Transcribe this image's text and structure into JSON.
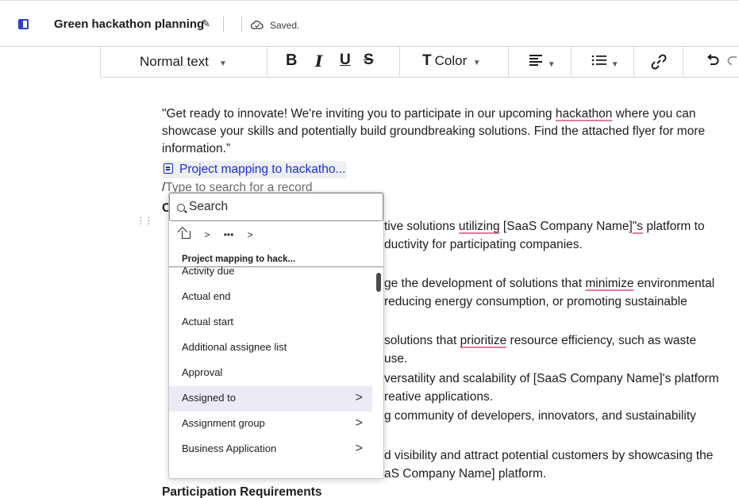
{
  "header": {
    "title": "Green hackathon planning",
    "status": "Saved."
  },
  "toolbar": {
    "format": "Normal text",
    "bold": "B",
    "italic": "I",
    "underline": "U",
    "strike": "S",
    "color_label": "Color",
    "color_glyph": "T"
  },
  "document": {
    "intro_1": "\"Get ready to innovate! We're inviting you to participate in our upcoming ",
    "intro_word": "hackathon",
    "intro_2": " where you can showcase your skills and potentially build groundbreaking solutions. Find the attached flyer for more information.”",
    "record_link": "Project mapping to hackatho...",
    "slash": "/",
    "slash_placeholder": "Type to search for a record",
    "hidden_initial": "O",
    "line1_a": "tive solutions ",
    "line1_word": "utilizing",
    "line1_b": " [SaaS Company Name]",
    "line1_c": "\"s",
    "line1_d": " platform to",
    "line2": "ductivity for participating companies.",
    "line3_a": "ge the development of solutions that ",
    "line3_word": "minimize",
    "line3_b": " environmental",
    "line4": "reducing energy consumption, or promoting sustainable",
    "line5_a": "solutions that ",
    "line5_word": "prioritize",
    "line5_b": " resource efficiency, such as waste",
    "line6": "use.",
    "line7": "versatility and scalability of [SaaS Company Name]'s platform",
    "line8": "reative applications.",
    "line9": "g community of developers, innovators, and sustainability",
    "line10": "d visibility and attract potential customers by showcasing the",
    "line11": "aS Company Name] platform.",
    "heading": "Participation Requirements"
  },
  "picker": {
    "search_placeholder": "Search",
    "crumb_sep": ">",
    "crumb_more": "•••",
    "group_title": "Project mapping to hack...",
    "items": [
      {
        "label": "Activity due",
        "has_children": false
      },
      {
        "label": "Actual end",
        "has_children": false
      },
      {
        "label": "Actual start",
        "has_children": false
      },
      {
        "label": "Additional assignee list",
        "has_children": false
      },
      {
        "label": "Approval",
        "has_children": false
      },
      {
        "label": "Assigned to",
        "has_children": true
      },
      {
        "label": "Assignment group",
        "has_children": true
      },
      {
        "label": "Business Application",
        "has_children": true
      }
    ],
    "chevron": ">"
  },
  "colors": {
    "accent": "#2f3bd6",
    "link": "#1a2cdb",
    "highlight_row": "#ebebf5",
    "spell_underline": "#e57aa3"
  },
  "icons": [
    "panel-toggle-icon",
    "pencil-icon",
    "cloud-icon",
    "align-icon",
    "list-icon",
    "link-icon",
    "undo-icon",
    "redo-icon",
    "search-icon",
    "home-icon",
    "document-icon",
    "drag-handle-icon"
  ]
}
